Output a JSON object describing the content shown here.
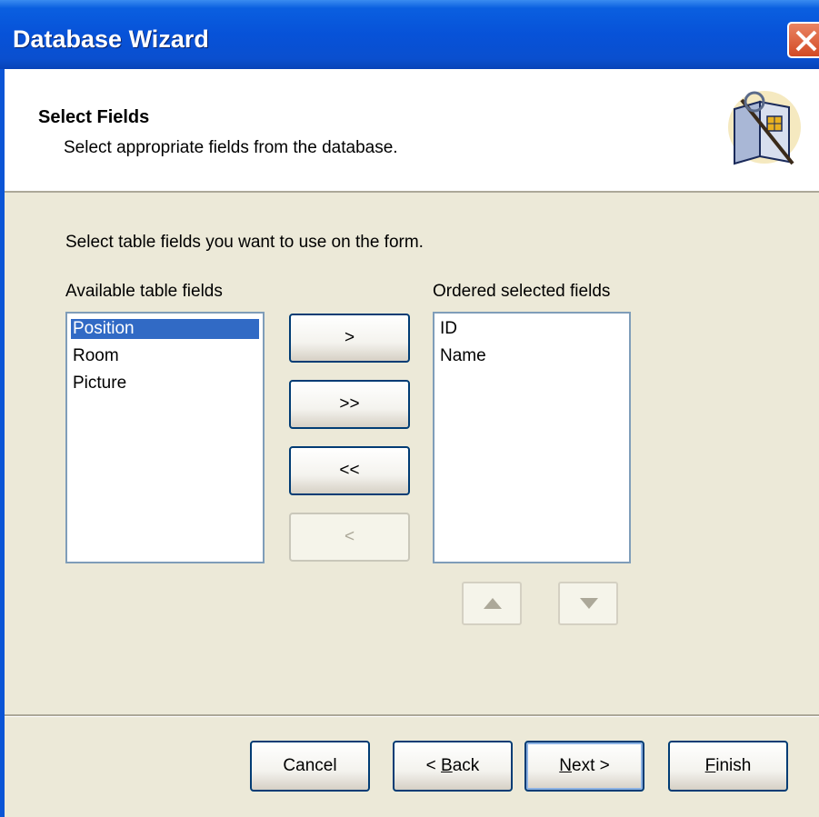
{
  "window": {
    "title": "Database Wizard"
  },
  "header": {
    "title": "Select Fields",
    "subtitle": "Select appropriate fields from the database."
  },
  "main": {
    "instruction": "Select table fields you want to use on the form.",
    "available_label": "Available table fields",
    "available_items": [
      "Position",
      "Room",
      "Picture"
    ],
    "available_selected": "Position",
    "selected_label": "Ordered selected fields",
    "selected_items": [
      "ID",
      "Name"
    ],
    "move_buttons": {
      "add_one": ">",
      "add_all": ">>",
      "remove_all": "<<",
      "remove_one": "<"
    }
  },
  "footer": {
    "cancel": "Cancel",
    "back_prefix": "< ",
    "back_mnemonic": "B",
    "back_rest": "ack",
    "next_mnemonic": "N",
    "next_rest": "ext >",
    "finish_mnemonic": "F",
    "finish_rest": "inish"
  },
  "colors": {
    "titlebar": "#0752d8",
    "selection": "#316ac5",
    "face": "#ece9d8"
  },
  "icons": {
    "close": "close-icon",
    "wizard": "wizard-book-icon",
    "up": "triangle-up-icon",
    "down": "triangle-down-icon"
  }
}
